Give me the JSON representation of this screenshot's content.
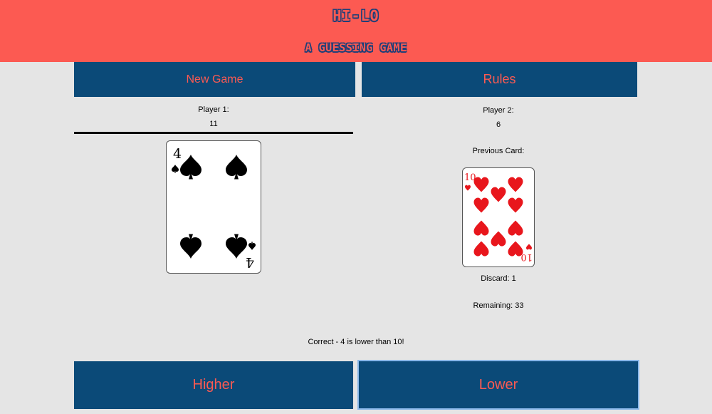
{
  "header": {
    "title": "HI-LO",
    "subtitle": "A GUESSING GAME"
  },
  "controls": {
    "new_game_label": "New Game",
    "rules_label": "Rules"
  },
  "player1": {
    "label": "Player 1:",
    "score": "11"
  },
  "player2": {
    "label": "Player 2:",
    "score": "6"
  },
  "current_card": {
    "rank": "4",
    "suit": "spades",
    "suit_symbol": "♠",
    "color": "#000000"
  },
  "previous": {
    "label": "Previous Card:",
    "rank": "10",
    "suit": "hearts",
    "suit_symbol": "♥",
    "color": "#e8161c"
  },
  "discard": {
    "text": "Discard: 1"
  },
  "remaining": {
    "text": "Remaining: 33"
  },
  "message": "Correct - 4 is lower than 10!",
  "guess": {
    "higher_label": "Higher",
    "lower_label": "Lower"
  },
  "colors": {
    "header_bg": "#fc5a52",
    "button_bg": "#0b4a78",
    "button_text": "#fc5a52",
    "page_bg": "#e5e5e5"
  }
}
